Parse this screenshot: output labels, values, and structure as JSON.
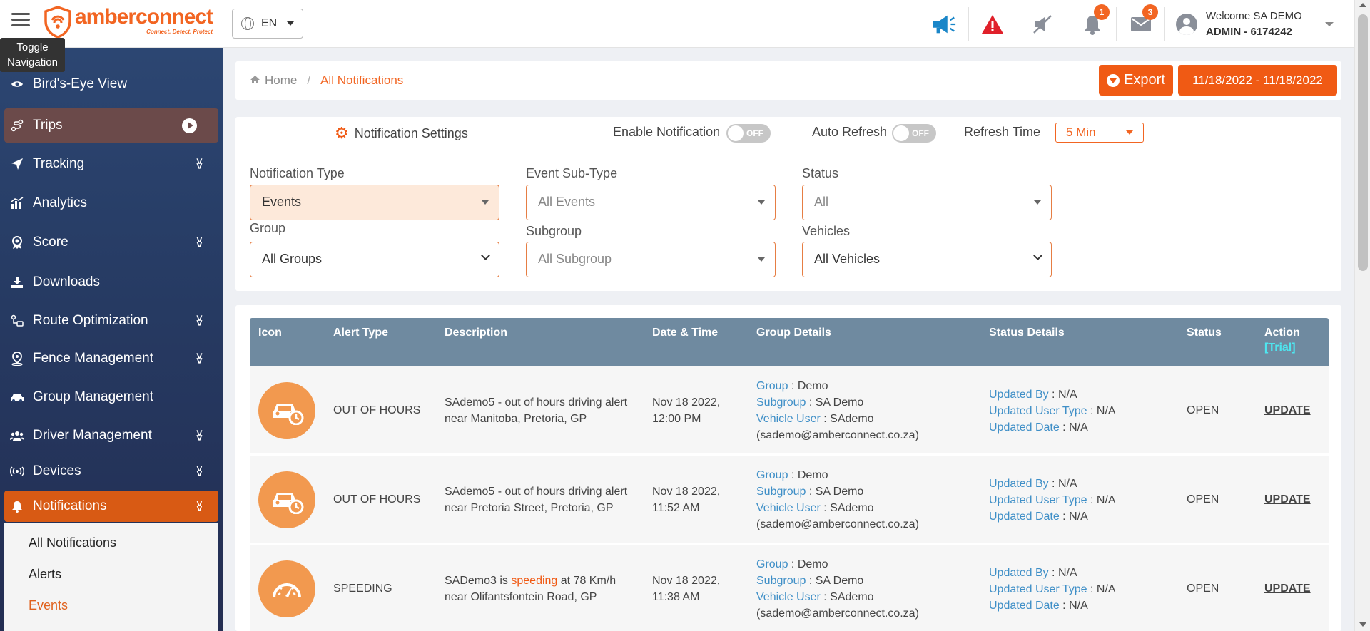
{
  "header": {
    "logo_name": "amberconnect",
    "logo_tagline": "Connect. Detect. Protect",
    "language": "EN",
    "toggle_tooltip": "Toggle Navigation",
    "notification_badge": "1",
    "mail_badge": "3",
    "user_welcome": "Welcome SA DEMO",
    "user_role": "ADMIN - 6174242"
  },
  "sidebar": {
    "items": [
      {
        "label": "Bird's-Eye View",
        "icon": "eye-icon"
      },
      {
        "label": "Trips",
        "icon": "route-icon"
      },
      {
        "label": "Tracking",
        "icon": "location-arrow-icon"
      },
      {
        "label": "Analytics",
        "icon": "bar-chart-icon"
      },
      {
        "label": "Score",
        "icon": "award-icon"
      },
      {
        "label": "Downloads",
        "icon": "download-icon"
      },
      {
        "label": "Route Optimization",
        "icon": "route-optimization-icon"
      },
      {
        "label": "Fence Management",
        "icon": "map-pin-icon"
      },
      {
        "label": "Group Management",
        "icon": "car-icon"
      },
      {
        "label": "Driver Management",
        "icon": "users-icon"
      },
      {
        "label": "Devices",
        "icon": "broadcast-icon"
      },
      {
        "label": "Notifications",
        "icon": "bell-icon"
      }
    ],
    "submenu": [
      "All Notifications",
      "Alerts",
      "Events"
    ]
  },
  "breadcrumb": {
    "home": "Home",
    "current": "All Notifications"
  },
  "actions": {
    "export": "Export",
    "date_range": "11/18/2022 - 11/18/2022"
  },
  "settings": {
    "title": "Notification Settings",
    "enable_label": "Enable Notification",
    "enable_state": "OFF",
    "auto_refresh_label": "Auto Refresh",
    "auto_refresh_state": "OFF",
    "refresh_time_label": "Refresh Time",
    "refresh_time_value": "5 Min"
  },
  "filters": {
    "notification_type": {
      "label": "Notification Type",
      "value": "Events"
    },
    "event_subtype": {
      "label": "Event Sub-Type",
      "value": "All Events"
    },
    "status": {
      "label": "Status",
      "value": "All"
    },
    "group": {
      "label": "Group",
      "value": "All Groups"
    },
    "subgroup": {
      "label": "Subgroup",
      "value": "All Subgroup"
    },
    "vehicles": {
      "label": "Vehicles",
      "value": "All Vehicles"
    }
  },
  "table": {
    "headers": [
      "Icon",
      "Alert Type",
      "Description",
      "Date & Time",
      "Group Details",
      "Status Details",
      "Status",
      "Action"
    ],
    "action_note": "[Trial]",
    "keys": {
      "group": "Group",
      "subgroup": "Subgroup",
      "vehicle_user": "Vehicle User",
      "updated_by": "Updated By",
      "updated_user_type": "Updated User Type",
      "updated_date": "Updated Date"
    },
    "rows": [
      {
        "icon": "car-clock-icon",
        "alert_type": "OUT OF HOURS",
        "description_1": "SAdemo5 - out of hours driving alert",
        "description_2": "near Manitoba, Pretoria, GP",
        "date": "Nov 18 2022,",
        "time": "12:00 PM",
        "group": "Demo",
        "subgroup": "SA Demo",
        "vehicle_user": "SAdemo",
        "vehicle_email": "(sademo@amberconnect.co.za)",
        "updated_by": "N/A",
        "updated_user_type": "N/A",
        "updated_date": "N/A",
        "status": "OPEN",
        "action": "UPDATE"
      },
      {
        "icon": "car-clock-icon",
        "alert_type": "OUT OF HOURS",
        "description_1": "SAdemo5 - out of hours driving alert",
        "description_2": "near Pretoria Street, Pretoria, GP",
        "date": "Nov 18 2022,",
        "time": "11:52 AM",
        "group": "Demo",
        "subgroup": "SA Demo",
        "vehicle_user": "SAdemo",
        "vehicle_email": "(sademo@amberconnect.co.za)",
        "updated_by": "N/A",
        "updated_user_type": "N/A",
        "updated_date": "N/A",
        "status": "OPEN",
        "action": "UPDATE"
      },
      {
        "icon": "speedometer-icon",
        "alert_type": "SPEEDING",
        "description_pre": "SADemo3 is ",
        "description_highlight": "speeding",
        "description_post": " at 78 Km/h",
        "description_2": "near Olifantsfontein Road, GP",
        "date": "Nov 18 2022,",
        "time": "11:38 AM",
        "group": "Demo",
        "subgroup": "SA Demo",
        "vehicle_user": "SAdemo",
        "vehicle_email": "(sademo@amberconnect.co.za)",
        "updated_by": "N/A",
        "updated_user_type": "N/A",
        "updated_date": "N/A",
        "status": "OPEN",
        "action": "UPDATE"
      }
    ]
  },
  "colors": {
    "accent": "#f05a14",
    "sidebar_bg": "#2c4672",
    "table_header": "#6f8aa0",
    "link_blue": "#3f8fc7",
    "status_open": "#e02020"
  }
}
